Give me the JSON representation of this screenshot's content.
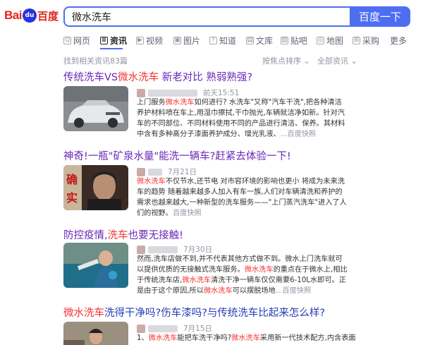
{
  "header": {
    "logo_text": "Bai",
    "logo_paw": "du",
    "logo_cn": "百度",
    "query": "微水洗车",
    "search_button": "百度一下"
  },
  "tabs": [
    {
      "icon": "web-icon",
      "glyph": "Q",
      "label": "网页"
    },
    {
      "icon": "news-icon",
      "glyph": "≡",
      "label": "资讯"
    },
    {
      "icon": "video-icon",
      "glyph": "▶",
      "label": "视频"
    },
    {
      "icon": "image-icon",
      "glyph": "▣",
      "label": "图片"
    },
    {
      "icon": "zhidao-icon",
      "glyph": "?",
      "label": "知道"
    },
    {
      "icon": "wenku-icon",
      "glyph": "▤",
      "label": "文库"
    },
    {
      "icon": "tieba-icon",
      "glyph": "▥",
      "label": "贴吧"
    },
    {
      "icon": "map-icon",
      "glyph": "◎",
      "label": "地图"
    },
    {
      "icon": "caigou-icon",
      "glyph": "⊞",
      "label": "采购"
    },
    {
      "icon": "",
      "glyph": "",
      "label": "更多"
    }
  ],
  "meta": {
    "count": "找到相关资讯83篇",
    "sort": "按焦点排序",
    "filter": "全部资讯"
  },
  "results": [
    {
      "title_a": "传统洗车VS",
      "title_em": "微水洗车",
      "title_b": " 新老对比 熟弱熟强?",
      "time": "前天15:51",
      "desc": [
        {
          "t": "上门服务"
        },
        {
          "em": "微水洗车"
        },
        {
          "t": "如何进行? 水洗车\"又称\"汽车干洗\",把各种清洁养护材料喷在车上,用湿巾擦拭,干巾抛光,车辆就洁净如新。针对汽车的不同部位、不同材料使用不同的产品进行清洁、保养。其材料中含有多种高分子漆面养护成分、增光乳液、"
        },
        {
          "snap": "...百度快照"
        }
      ]
    },
    {
      "title_a": "神奇!一瓶\"矿泉水量\"能洗一辆车?赶紧去体验一下!",
      "title_em": "",
      "title_b": "",
      "time": "7月21日",
      "desc": [
        {
          "em": "微水洗车"
        },
        {
          "t": "不仅节水,还节电 对市容环境的影响也更小 将成为未来洗车的趋势 随着越来越多人加入有车一族,人们对车辆清洗和养护的需求也越来越大,一种新型的洗车服务——\"上门蒸汽洗车\"进入了人们的视野。"
        },
        {
          "snap": "百度快照"
        }
      ]
    },
    {
      "title_a": "防控疫情,",
      "title_em": "洗车",
      "title_b": "也要无接触!",
      "time": "7月30日",
      "desc": [
        {
          "t": "然而,洗车店做不到,并不代表其他方式做不到。微水上门洗车就可以提供优质的无接触式洗车服务。"
        },
        {
          "em": "微水洗车"
        },
        {
          "t": "的重点在于微水上,相比于传统洗车店,"
        },
        {
          "em": "微水洗车"
        },
        {
          "t": "清洗干净一辆车仅仅需要6-10L水即可。正是由于这个原因,所以"
        },
        {
          "em": "微水洗车"
        },
        {
          "t": "可以摆脱场地"
        },
        {
          "snap": "...百度快照"
        }
      ]
    },
    {
      "title_a": "",
      "title_em": "微水洗车",
      "title_b": "洗得干净吗?伤车漆吗?与传统洗车比起来怎么样?",
      "time": "7月15日",
      "desc": [
        {
          "t": "1、"
        },
        {
          "em": "微水洗车"
        },
        {
          "t": "能把车洗干净吗?"
        },
        {
          "em": "微水洗车"
        },
        {
          "t": "采用新一代技术配方,内含表面"
        }
      ]
    }
  ],
  "colors": {
    "brand_blue": "#4e6ef2",
    "link_blue": "#2440b3",
    "visited_purple": "#6a28b5",
    "highlight_red": "#f73131"
  }
}
